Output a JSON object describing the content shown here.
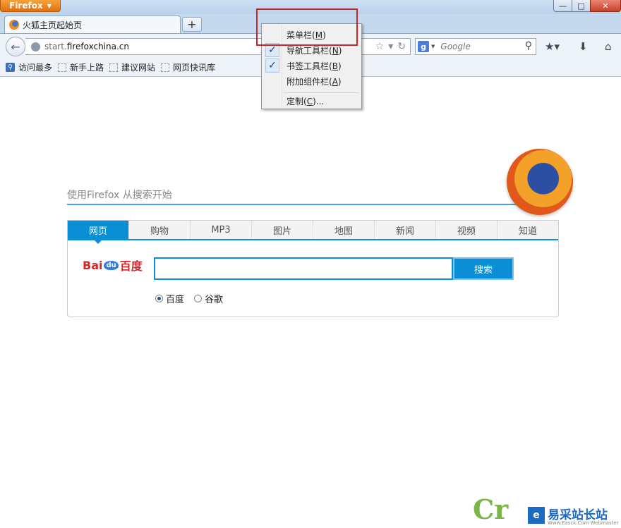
{
  "window": {
    "app_button": "Firefox",
    "minimize": "—",
    "maximize": "□",
    "close": "✕"
  },
  "tabs": [
    {
      "title": "火狐主页起始页"
    }
  ],
  "newtab_label": "+",
  "navbar": {
    "url_prefix": "start.",
    "url_domain": "firefoxchina.cn",
    "search_engine_letter": "g",
    "search_placeholder": "Google"
  },
  "bookmarks": [
    "访问最多",
    "新手上路",
    "建议网站",
    "网页快讯库"
  ],
  "context_menu": {
    "items": [
      {
        "label": "菜单栏",
        "key": "M",
        "checked": false
      },
      {
        "label": "导航工具栏",
        "key": "N",
        "checked": true
      },
      {
        "label": "书签工具栏",
        "key": "B",
        "checked": true
      },
      {
        "label": "附加组件栏",
        "key": "A",
        "checked": false
      },
      {
        "label": "定制",
        "key": "C",
        "suffix": "...",
        "checked": false
      }
    ]
  },
  "page": {
    "slogan": "使用Firefox  从搜索开始",
    "search_tabs": [
      "网页",
      "购物",
      "MP3",
      "图片",
      "地图",
      "新闻",
      "视频",
      "知道"
    ],
    "active_tab": 0,
    "baidu_logo": {
      "left": "Bai",
      "paw": "du",
      "right": "百度"
    },
    "search_button": "搜索",
    "radios": [
      {
        "label": "百度",
        "checked": true
      },
      {
        "label": "谷歌",
        "checked": false
      }
    ]
  },
  "watermark": {
    "brand": "易采站长站",
    "sub": "Www.Easck.Com Webmaster",
    "logo_letter": "e",
    "ribbon_letter": "Cr"
  },
  "colors": {
    "accent": "#0a8fd6",
    "highlight_border": "#c9262c",
    "ff_orange": "#e26f0a"
  }
}
